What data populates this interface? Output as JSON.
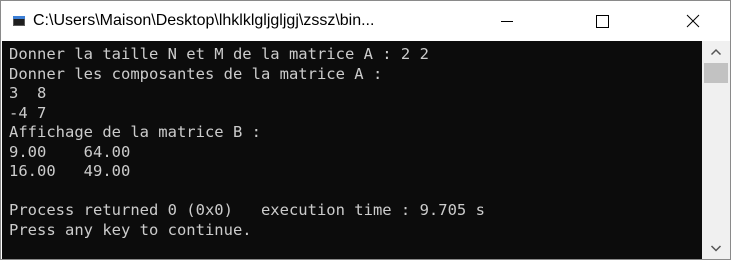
{
  "window": {
    "title": "C:\\Users\\Maison\\Desktop\\lhklklgljgljgj\\zssz\\bin..."
  },
  "title_controls": {
    "minimize_icon": "minimize-icon",
    "maximize_icon": "maximize-icon",
    "close_icon": "close-icon"
  },
  "console": {
    "background": "#0c0c0c",
    "foreground": "#cccccc",
    "lines": [
      "Donner la taille N et M de la matrice A : 2 2",
      "Donner les composantes de la matrice A :",
      "3  8",
      "-4 7",
      "Affichage de la matrice B :",
      "9.00    64.00",
      "16.00   49.00",
      "",
      "Process returned 0 (0x0)   execution time : 9.705 s",
      "Press any key to continue."
    ]
  },
  "scrollbar": {
    "up_icon": "chevron-up-icon",
    "down_icon": "chevron-down-icon"
  }
}
